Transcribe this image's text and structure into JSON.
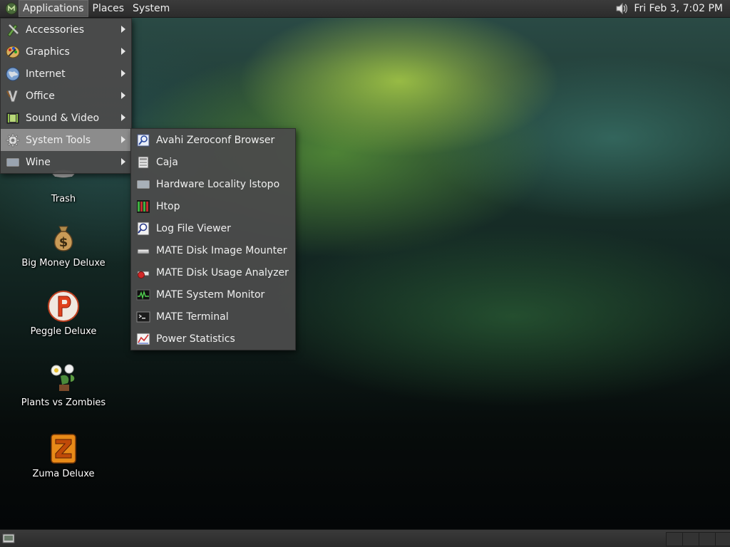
{
  "top_panel": {
    "menus": [
      "Applications",
      "Places",
      "System"
    ],
    "clock": "Fri Feb  3,  7:02 PM"
  },
  "app_menu": {
    "items": [
      {
        "label": "Accessories",
        "icon": "accessories-icon"
      },
      {
        "label": "Graphics",
        "icon": "graphics-icon"
      },
      {
        "label": "Internet",
        "icon": "internet-icon"
      },
      {
        "label": "Office",
        "icon": "office-icon"
      },
      {
        "label": "Sound & Video",
        "icon": "sound-video-icon"
      },
      {
        "label": "System Tools",
        "icon": "gear-icon"
      },
      {
        "label": "Wine",
        "icon": "wine-icon"
      }
    ],
    "selected": "System Tools"
  },
  "system_tools_menu": {
    "items": [
      {
        "label": "Avahi Zeroconf Browser",
        "icon": "avahi-icon"
      },
      {
        "label": "Caja",
        "icon": "caja-icon"
      },
      {
        "label": "Hardware Locality lstopo",
        "icon": "hardware-icon"
      },
      {
        "label": "Htop",
        "icon": "htop-icon"
      },
      {
        "label": "Log File Viewer",
        "icon": "log-viewer-icon"
      },
      {
        "label": "MATE Disk Image Mounter",
        "icon": "disk-mounter-icon"
      },
      {
        "label": "MATE Disk Usage Analyzer",
        "icon": "disk-usage-icon"
      },
      {
        "label": "MATE System Monitor",
        "icon": "system-monitor-icon"
      },
      {
        "label": "MATE Terminal",
        "icon": "terminal-icon"
      },
      {
        "label": "Power Statistics",
        "icon": "power-stats-icon"
      }
    ]
  },
  "desktop_icons": [
    {
      "label": "Trash",
      "icon": "trash-icon"
    },
    {
      "label": "Big Money Deluxe",
      "icon": "money-bag-icon"
    },
    {
      "label": "Peggle Deluxe",
      "icon": "peggle-icon"
    },
    {
      "label": "Plants vs Zombies",
      "icon": "plants-icon"
    },
    {
      "label": "Zuma Deluxe",
      "icon": "zuma-icon"
    }
  ]
}
